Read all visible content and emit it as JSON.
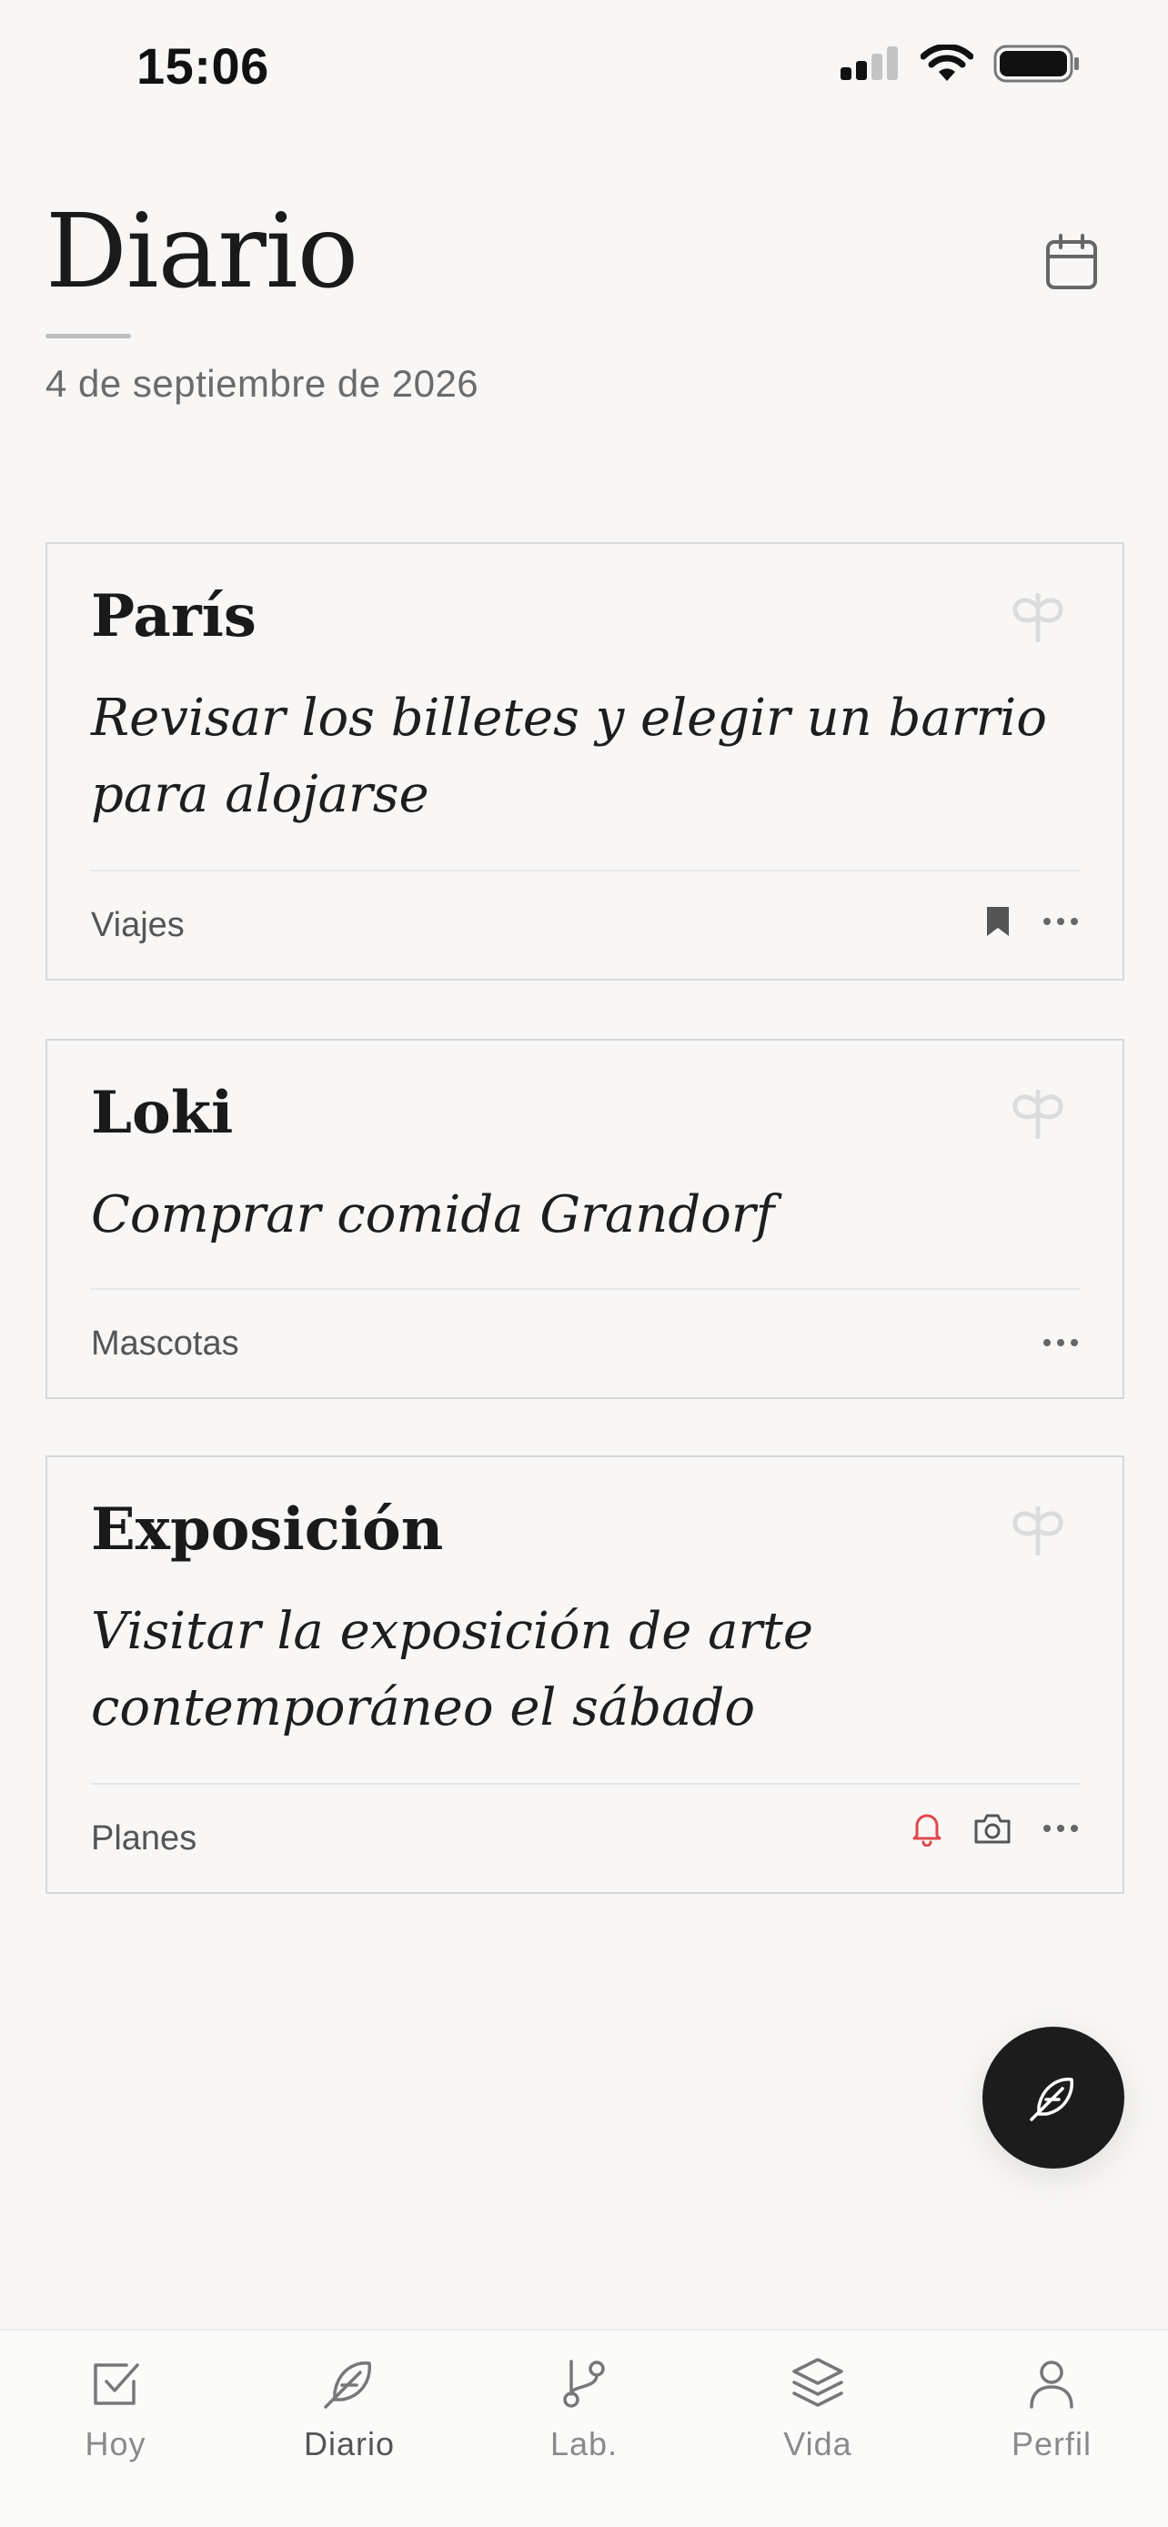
{
  "status_bar": {
    "time": "15:06"
  },
  "header": {
    "title": "Diario",
    "date": "4 de septiembre de 2026",
    "calendar_icon": "calendar-icon"
  },
  "entries": [
    {
      "title": "París",
      "body": "Revisar los billetes y elegir un barrio para alojarse",
      "tag": "Viajes",
      "actions": [
        "bookmark-icon",
        "more-icon"
      ]
    },
    {
      "title": "Loki",
      "body": "Comprar comida Grandorf",
      "tag": "Mascotas",
      "actions": [
        "more-icon"
      ]
    },
    {
      "title": "Exposición",
      "body": "Visitar la exposición de arte contemporáneo el sábado",
      "tag": "Planes",
      "actions": [
        "bell-icon",
        "camera-icon",
        "more-icon"
      ]
    }
  ],
  "fab": {
    "icon": "feather-icon"
  },
  "bottom_nav": [
    {
      "label": "Hoy",
      "icon": "checkbox-icon"
    },
    {
      "label": "Diario",
      "icon": "feather-icon",
      "active": true
    },
    {
      "label": "Lab.",
      "icon": "branch-icon"
    },
    {
      "label": "Vida",
      "icon": "layers-icon"
    },
    {
      "label": "Perfil",
      "icon": "user-icon"
    }
  ],
  "colors": {
    "background": "#f8f7f5",
    "text": "#1c1c1c",
    "muted": "#6b6b6b",
    "alert": "#e0474c",
    "fab": "#1c1c1c"
  }
}
